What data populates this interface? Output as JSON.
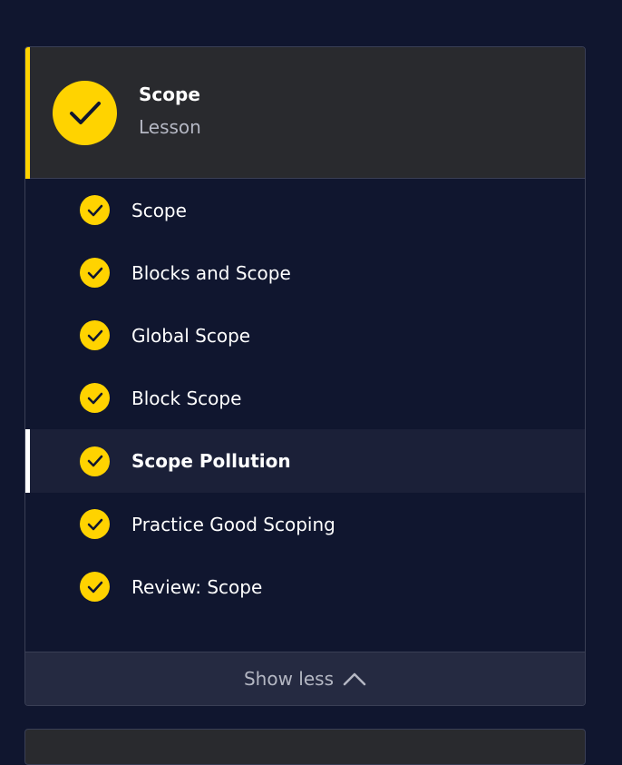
{
  "lesson": {
    "title": "Scope",
    "type_label": "Lesson",
    "status_icon": "check-circle-icon"
  },
  "items": [
    {
      "label": "Scope",
      "completed": true
    },
    {
      "label": "Blocks and Scope",
      "completed": true
    },
    {
      "label": "Global Scope",
      "completed": true
    },
    {
      "label": "Block Scope",
      "completed": true
    },
    {
      "label": "Scope Pollution",
      "completed": true,
      "active": true
    },
    {
      "label": "Practice Good Scoping",
      "completed": true
    },
    {
      "label": "Review: Scope",
      "completed": true
    }
  ],
  "toggle": {
    "label": "Show less",
    "icon": "chevron-up-icon"
  },
  "colors": {
    "background": "#10162f",
    "accent": "#ffd300",
    "header_bg": "#292a2e",
    "active_row_bg": "#1b2038",
    "button_bg": "#252a41"
  }
}
